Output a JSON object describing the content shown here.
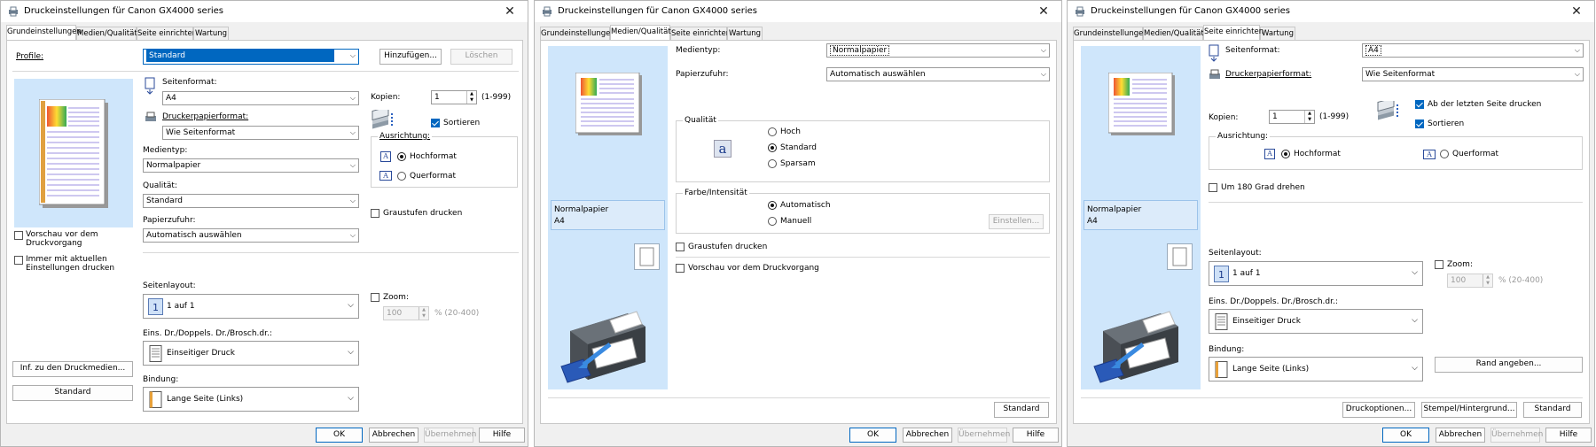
{
  "window_title": "Druckeinstellungen für Canon GX4000 series",
  "tabs": [
    "Grundeinstellungen",
    "Medien/Qualität",
    "Seite einrichten",
    "Wartung"
  ],
  "footer": {
    "ok": "OK",
    "cancel": "Abbrechen",
    "apply": "Übernehmen",
    "help": "Hilfe"
  },
  "w1": {
    "profile_label": "Profile:",
    "profile_value": "Standard",
    "add_btn": "Hinzufügen...",
    "delete_btn": "Löschen",
    "page_size_label": "Seitenformat:",
    "page_size_value": "A4",
    "printer_paper_label": "Druckerpapierformat:",
    "printer_paper_value": "Wie Seitenformat",
    "media_label": "Medientyp:",
    "media_value": "Normalpapier",
    "quality_label": "Qualität:",
    "quality_value": "Standard",
    "source_label": "Papierzufuhr:",
    "source_value": "Automatisch auswählen",
    "copies_label": "Kopien:",
    "copies_value": "1",
    "copies_range": "(1-999)",
    "collate": "Sortieren",
    "orientation_label": "Ausrichtung:",
    "portrait": "Hochformat",
    "landscape": "Querformat",
    "grayscale": "Graustufen drucken",
    "preview_cb": "Vorschau vor dem Druckvorgang",
    "always_cb": "Immer mit aktuellen Einstellungen drucken",
    "layout_label": "Seitenlayout:",
    "layout_value": "1 auf 1",
    "duplex_label": "Eins. Dr./Doppels. Dr./Brosch.dr.:",
    "duplex_value": "Einseitiger Druck",
    "binding_label": "Bindung:",
    "binding_value": "Lange Seite (Links)",
    "zoom_label": "Zoom:",
    "zoom_value": "100",
    "zoom_range": "% (20-400)",
    "info_btn": "Inf. zu den Druckmedien...",
    "std_btn": "Standard"
  },
  "w2": {
    "media_label": "Medientyp:",
    "media_value": "Normalpapier",
    "source_label": "Papierzufuhr:",
    "source_value": "Automatisch auswählen",
    "quality_label": "Qualität",
    "q_high": "Hoch",
    "q_std": "Standard",
    "q_save": "Sparsam",
    "color_label": "Farbe/Intensität",
    "c_auto": "Automatisch",
    "c_manual": "Manuell",
    "set_btn": "Einstellen...",
    "grayscale": "Graustufen drucken",
    "preview_cb": "Vorschau vor dem Druckvorgang",
    "paper_line1": "Normalpapier",
    "paper_line2": "A4",
    "std_btn": "Standard"
  },
  "w3": {
    "page_size_label": "Seitenformat:",
    "page_size_value": "A4",
    "printer_paper_label": "Druckerpapierformat:",
    "printer_paper_value": "Wie Seitenformat",
    "copies_label": "Kopien:",
    "copies_value": "1",
    "copies_range": "(1-999)",
    "last_page": "Ab der letzten Seite drucken",
    "collate": "Sortieren",
    "orientation_label": "Ausrichtung:",
    "portrait": "Hochformat",
    "landscape": "Querformat",
    "rotate": "Um 180 Grad drehen",
    "paper_line1": "Normalpapier",
    "paper_line2": "A4",
    "layout_label": "Seitenlayout:",
    "layout_value": "1 auf 1",
    "zoom_label": "Zoom:",
    "zoom_value": "100",
    "zoom_range": "% (20-400)",
    "duplex_label": "Eins. Dr./Doppels. Dr./Brosch.dr.:",
    "duplex_value": "Einseitiger Druck",
    "binding_label": "Bindung:",
    "binding_value": "Lange Seite (Links)",
    "margin_btn": "Rand angeben...",
    "print_opts_btn": "Druckoptionen...",
    "stamp_btn": "Stempel/Hintergrund...",
    "std_btn": "Standard"
  }
}
